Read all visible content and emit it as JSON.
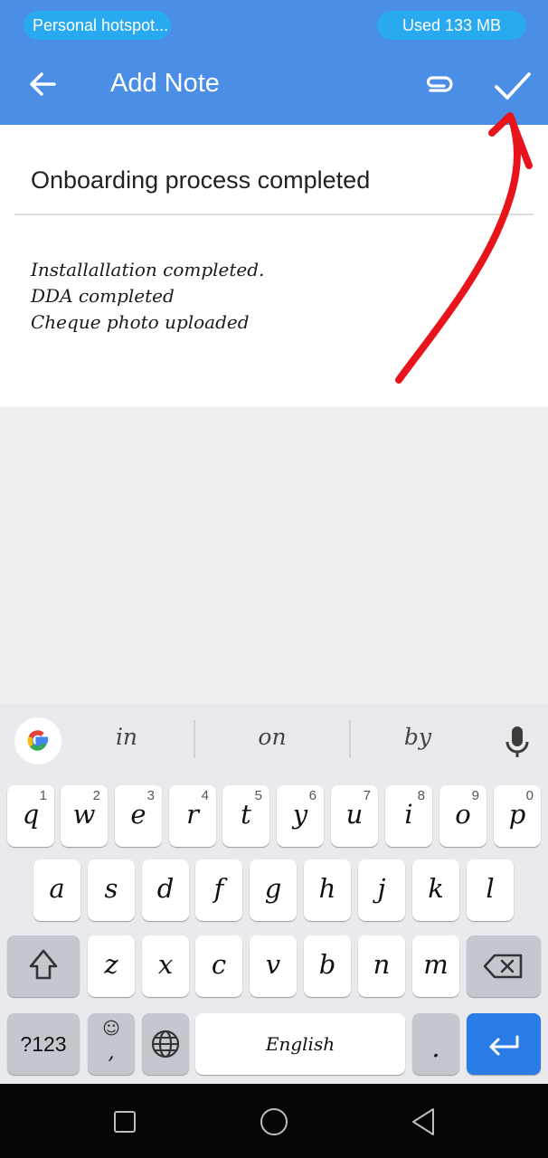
{
  "status_bar": {
    "hotspot_label": "Personal hotspot...",
    "data_usage": "Used  133 MB"
  },
  "app_bar": {
    "title": "Add Note",
    "back_icon": "arrow-left-icon",
    "attach_icon": "paperclip-icon",
    "save_icon": "check-icon"
  },
  "note": {
    "title": "Onboarding process completed",
    "body": "Installallation completed.\nDDA completed\nCheque photo uploaded"
  },
  "keyboard": {
    "suggestions": [
      "in",
      "on",
      "by"
    ],
    "row1": [
      {
        "label": "q",
        "hint": "1"
      },
      {
        "label": "w",
        "hint": "2"
      },
      {
        "label": "e",
        "hint": "3"
      },
      {
        "label": "r",
        "hint": "4"
      },
      {
        "label": "t",
        "hint": "5"
      },
      {
        "label": "y",
        "hint": "6"
      },
      {
        "label": "u",
        "hint": "7"
      },
      {
        "label": "i",
        "hint": "8"
      },
      {
        "label": "o",
        "hint": "9"
      },
      {
        "label": "p",
        "hint": "0"
      }
    ],
    "row2": [
      "a",
      "s",
      "d",
      "f",
      "g",
      "h",
      "j",
      "k",
      "l"
    ],
    "row3": [
      "z",
      "x",
      "c",
      "v",
      "b",
      "n",
      "m"
    ],
    "symbols_label": "?123",
    "emoji_comma_label": ",",
    "space_label": "English",
    "period_label": "."
  },
  "colors": {
    "accent": "#4a8ee6",
    "hotspot_pill": "#29aaf0",
    "annotation_arrow": "#e8141c",
    "enter_key": "#2a7de6"
  }
}
